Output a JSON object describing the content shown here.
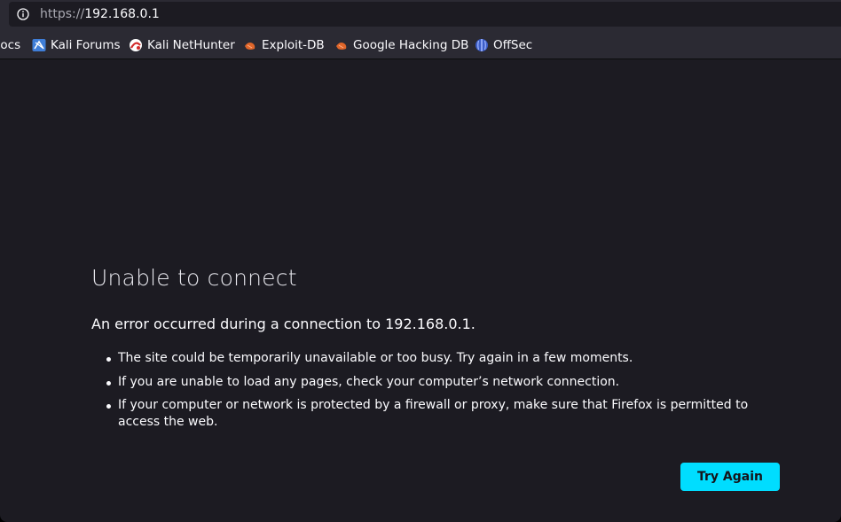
{
  "urlbar": {
    "scheme": "https://",
    "host": "192.168.0.1"
  },
  "bookmarks": [
    {
      "label": "Docs",
      "icon": "docs-icon"
    },
    {
      "label": "Kali Forums",
      "icon": "kali-forums-icon"
    },
    {
      "label": "Kali NetHunter",
      "icon": "kali-nethunter-icon"
    },
    {
      "label": "Exploit-DB",
      "icon": "exploit-db-icon"
    },
    {
      "label": "Google Hacking DB",
      "icon": "google-hacking-db-icon"
    },
    {
      "label": "OffSec",
      "icon": "offsec-icon"
    }
  ],
  "error": {
    "title": "Unable to connect",
    "description": "An error occurred during a connection to 192.168.0.1.",
    "bullets": [
      "The site could be temporarily unavailable or too busy. Try again in a few moments.",
      "If you are unable to load any pages, check your computer’s network connection.",
      "If your computer or network is protected by a firewall or proxy, make sure that Firefox is permitted to access the web."
    ],
    "button_label": "Try Again"
  },
  "colors": {
    "page_background": "#1c1b22",
    "toolbar_background": "#2b2a33",
    "button_accent": "#00ddff"
  }
}
